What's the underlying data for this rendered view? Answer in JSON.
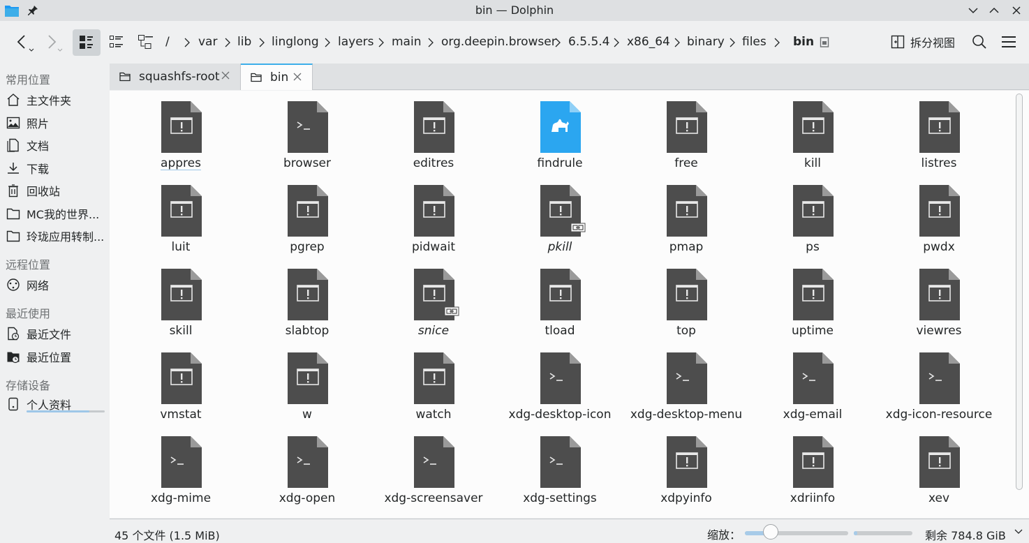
{
  "window": {
    "title": "bin — Dolphin"
  },
  "toolbar": {
    "split_label": "拆分视图"
  },
  "breadcrumb": [
    {
      "label": "/"
    },
    {
      "label": "var"
    },
    {
      "label": "lib"
    },
    {
      "label": "linglong"
    },
    {
      "label": "layers"
    },
    {
      "label": "main"
    },
    {
      "label": "org.deepin.browser"
    },
    {
      "label": "6.5.5.4"
    },
    {
      "label": "x86_64"
    },
    {
      "label": "binary"
    },
    {
      "label": "files"
    },
    {
      "label": "bin"
    }
  ],
  "sidebar": {
    "sections": [
      {
        "header": "常用位置"
      },
      {
        "header": "远程位置"
      },
      {
        "header": "最近使用"
      },
      {
        "header": "存储设备"
      }
    ],
    "items": [
      {
        "label": "主文件夹",
        "icon": "home-icon"
      },
      {
        "label": "照片",
        "icon": "image-icon"
      },
      {
        "label": "文档",
        "icon": "document-icon"
      },
      {
        "label": "下载",
        "icon": "download-icon"
      },
      {
        "label": "回收站",
        "icon": "trash-icon"
      },
      {
        "label": "MC我的世界...",
        "icon": "folder-icon"
      },
      {
        "label": "玲珑应用转制...",
        "icon": "folder-icon"
      },
      {
        "label": "网络",
        "icon": "network-icon"
      },
      {
        "label": "最近文件",
        "icon": "recent-files-icon"
      },
      {
        "label": "最近位置",
        "icon": "recent-locations-icon"
      },
      {
        "label": "个人资料",
        "icon": "drive-icon"
      }
    ]
  },
  "tabs": [
    {
      "label": "squashfs-root",
      "active": false
    },
    {
      "label": "bin",
      "active": true
    }
  ],
  "files": [
    {
      "name": "appres",
      "type": "exec"
    },
    {
      "name": "browser",
      "type": "script"
    },
    {
      "name": "editres",
      "type": "exec"
    },
    {
      "name": "findrule",
      "type": "perl"
    },
    {
      "name": "free",
      "type": "exec"
    },
    {
      "name": "kill",
      "type": "exec"
    },
    {
      "name": "listres",
      "type": "exec"
    },
    {
      "name": "luit",
      "type": "exec"
    },
    {
      "name": "pgrep",
      "type": "exec"
    },
    {
      "name": "pidwait",
      "type": "exec"
    },
    {
      "name": "pkill",
      "type": "exec-link"
    },
    {
      "name": "pmap",
      "type": "exec"
    },
    {
      "name": "ps",
      "type": "exec"
    },
    {
      "name": "pwdx",
      "type": "exec"
    },
    {
      "name": "skill",
      "type": "exec"
    },
    {
      "name": "slabtop",
      "type": "exec"
    },
    {
      "name": "snice",
      "type": "exec-link"
    },
    {
      "name": "tload",
      "type": "exec"
    },
    {
      "name": "top",
      "type": "exec"
    },
    {
      "name": "uptime",
      "type": "exec"
    },
    {
      "name": "viewres",
      "type": "exec"
    },
    {
      "name": "vmstat",
      "type": "exec"
    },
    {
      "name": "w",
      "type": "exec"
    },
    {
      "name": "watch",
      "type": "exec"
    },
    {
      "name": "xdg-desktop-icon",
      "type": "script"
    },
    {
      "name": "xdg-desktop-menu",
      "type": "script"
    },
    {
      "name": "xdg-email",
      "type": "script"
    },
    {
      "name": "xdg-icon-resource",
      "type": "script"
    },
    {
      "name": "xdg-mime",
      "type": "script"
    },
    {
      "name": "xdg-open",
      "type": "script"
    },
    {
      "name": "xdg-screensaver",
      "type": "script"
    },
    {
      "name": "xdg-settings",
      "type": "script"
    },
    {
      "name": "xdpyinfo",
      "type": "exec"
    },
    {
      "name": "xdriinfo",
      "type": "exec"
    },
    {
      "name": "xev",
      "type": "exec"
    }
  ],
  "statusbar": {
    "summary": "45 个文件 (1.5 MiB)",
    "zoom_label": "缩放：",
    "zoom_fraction": 0.25,
    "space_used_fraction": 0.06,
    "free_space": "剩余 784.8 GiB"
  },
  "colors": {
    "accent": "#3daee9",
    "exec_icon": "#4d4d4d",
    "perl_icon": "#2ba6f0"
  }
}
